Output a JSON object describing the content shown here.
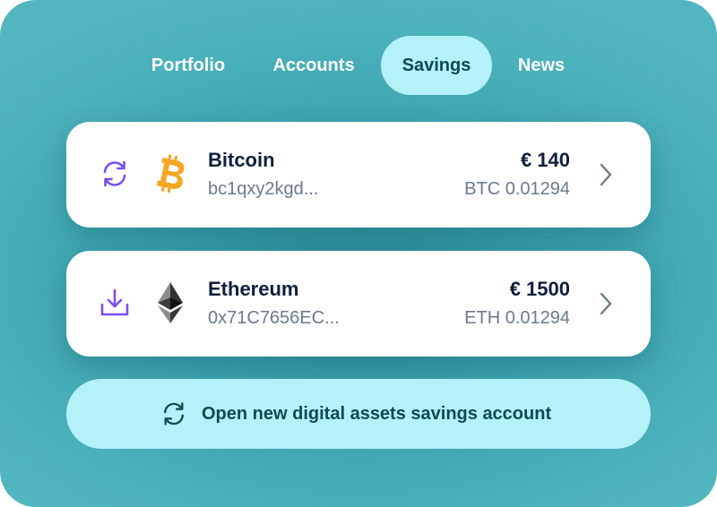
{
  "nav": {
    "tabs": [
      {
        "label": "Portfolio",
        "active": false
      },
      {
        "label": "Accounts",
        "active": false
      },
      {
        "label": "Savings",
        "active": true
      },
      {
        "label": "News",
        "active": false
      }
    ]
  },
  "accounts": [
    {
      "name": "Bitcoin",
      "address": "bc1qxy2kgd...",
      "amount": "€ 140",
      "crypto_amount": "BTC 0.01294",
      "action_icon": "refresh-icon",
      "coin_icon": "bitcoin-icon"
    },
    {
      "name": "Ethereum",
      "address": "0x71C7656EC...",
      "amount": "€ 1500",
      "crypto_amount": "ETH 0.01294",
      "action_icon": "download-icon",
      "coin_icon": "ethereum-icon"
    }
  ],
  "cta": {
    "label": "Open new digital assets savings account",
    "icon": "refresh-icon"
  },
  "colors": {
    "background": "#3aa3ae",
    "active_tab": "#b4f1f8",
    "accent_purple": "#7b4ff0",
    "bitcoin_orange": "#f5a623",
    "text_dark": "#0f1f3d",
    "text_muted": "#6b7a8c",
    "cta_text": "#0b4a57"
  }
}
